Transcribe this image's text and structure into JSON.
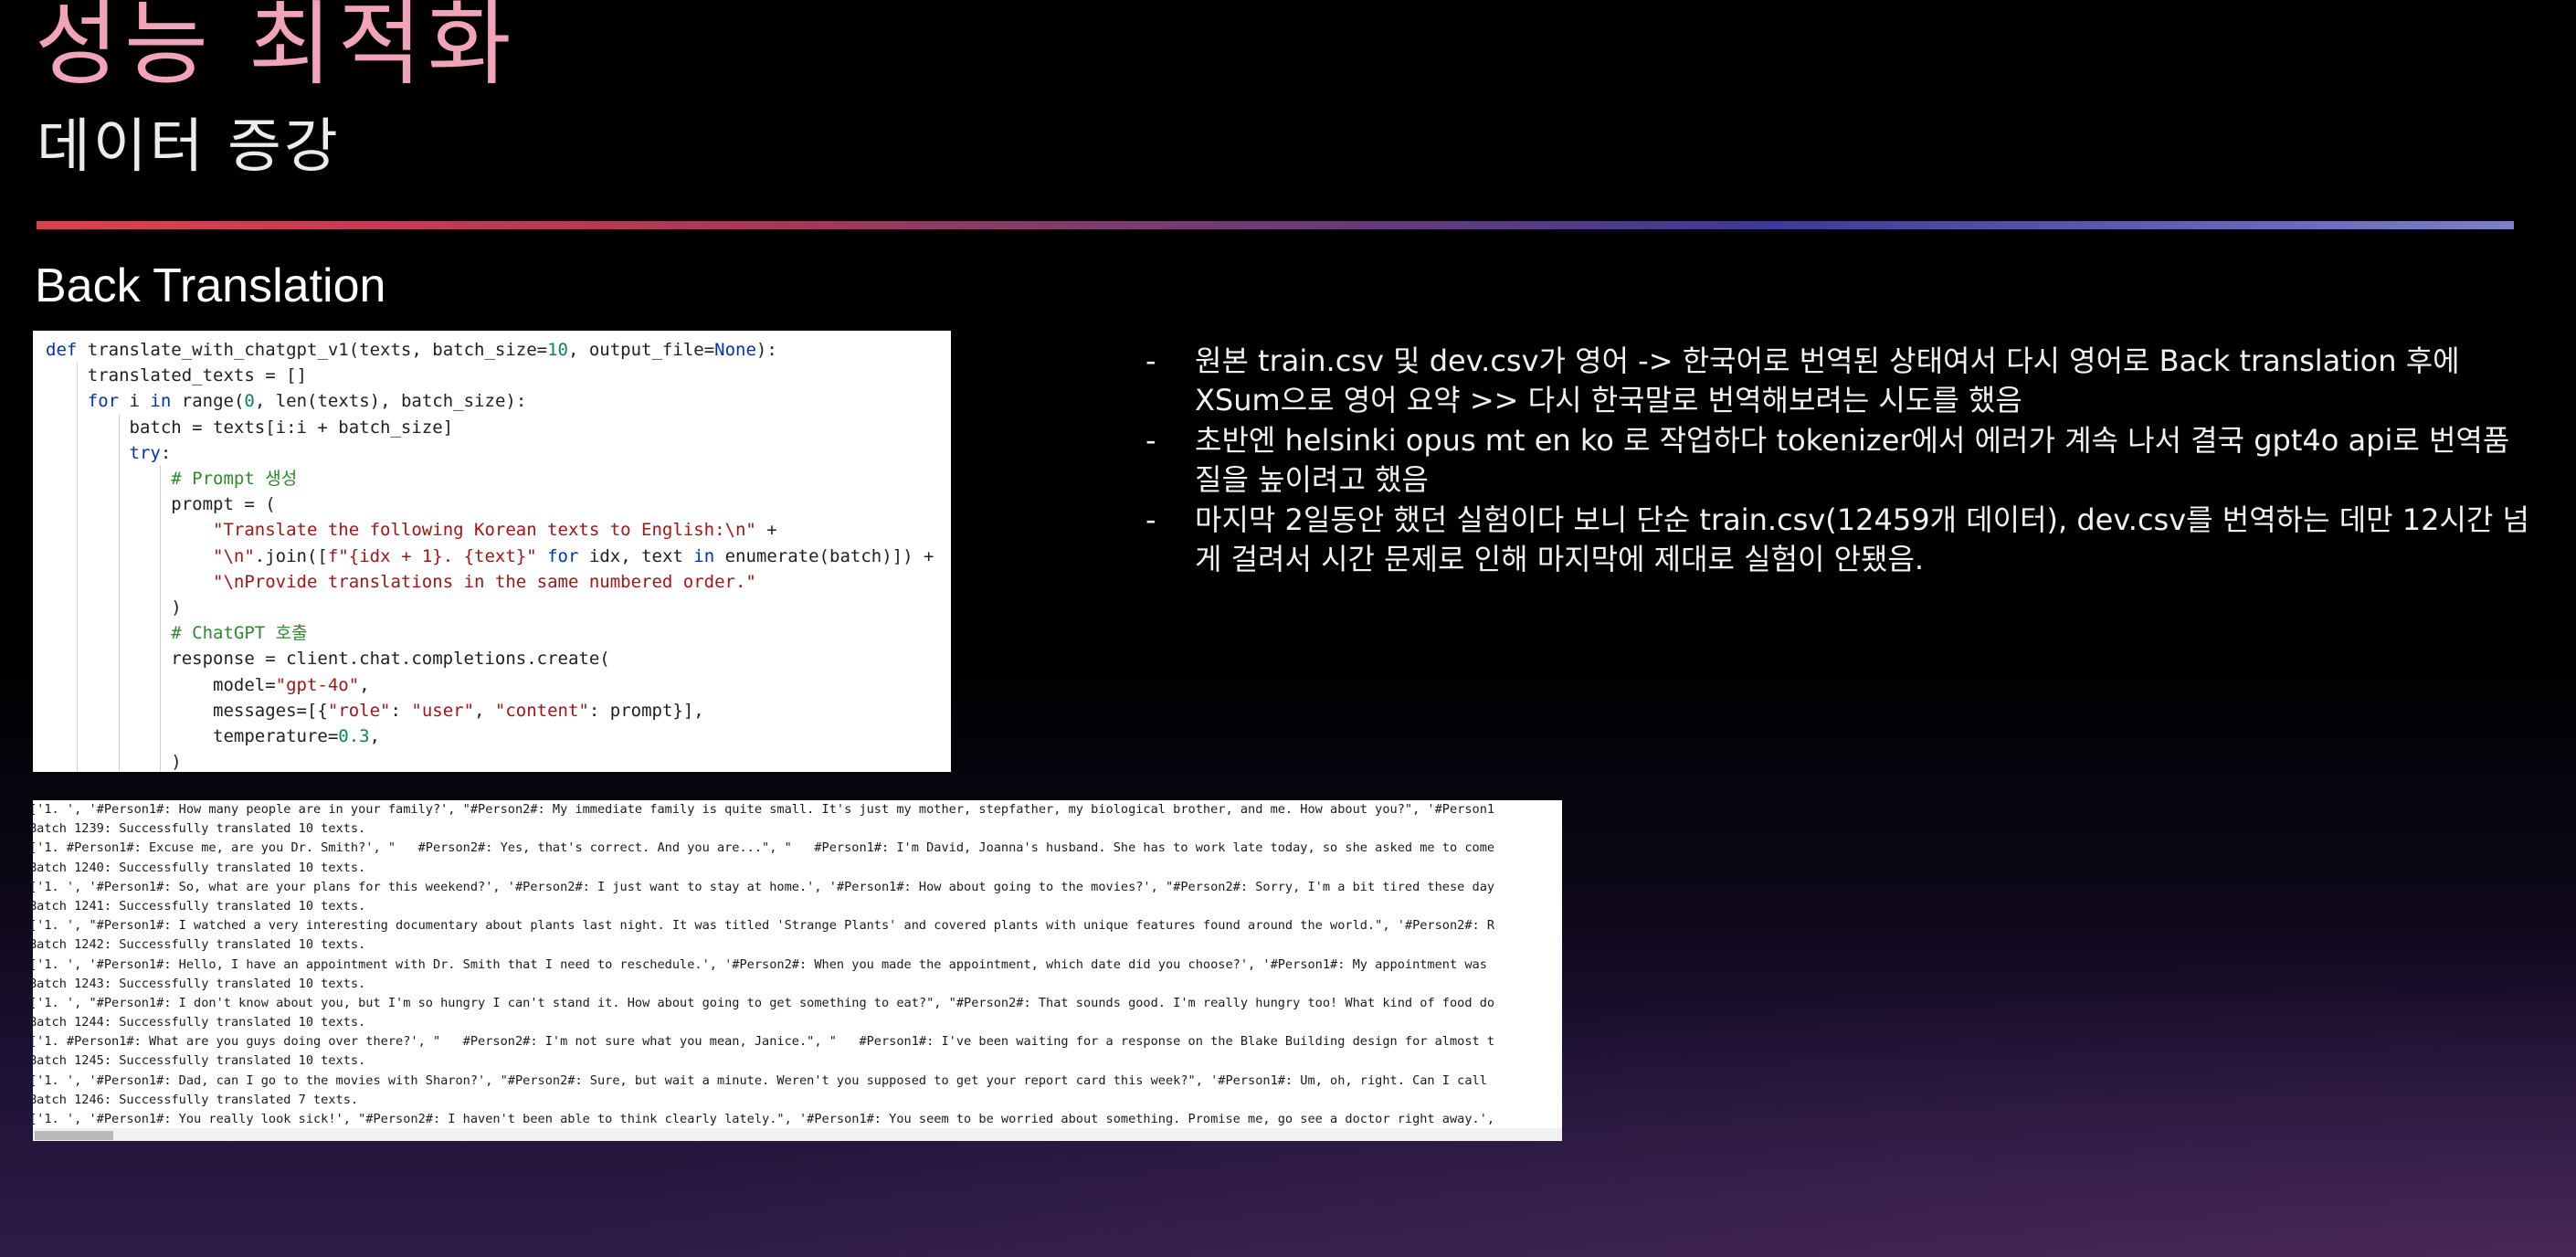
{
  "slide": {
    "title": "성능 최적화",
    "subtitle": "데이터 증강",
    "section_heading": "Back Translation"
  },
  "notes": [
    "원본 train.csv 및 dev.csv가 영어 -> 한국어로 번역된 상태여서 다시 영어로 Back translation 후에 XSum으로 영어 요약 >> 다시 한국말로 번역해보려는 시도를 했음",
    "초반엔 helsinki opus mt en ko 로 작업하다 tokenizer에서 에러가 계속 나서 결국 gpt4o api로 번역품질을 높이려고 했음",
    "마지막 2일동안 했던 실험이다 보니 단순 train.csv(12459개 데이터), dev.csv를 번역하는 데만 12시간 넘게 걸려서 시간 문제로 인해 마지막에 제대로 실험이 안됐음."
  ],
  "bullet_marker": "-",
  "code_lines": [
    "def translate_with_chatgpt_v1(texts, batch_size=10, output_file=None):",
    "    translated_texts = []",
    "    for i in range(0, len(texts), batch_size):",
    "        batch = texts[i:i + batch_size]",
    "        try:",
    "            # Prompt 생성",
    "            prompt = (",
    "                \"Translate the following Korean texts to English:\\n\" +",
    "                \"\\n\".join([f\"{idx + 1}. {text}\" for idx, text in enumerate(batch)]) +",
    "                \"\\nProvide translations in the same numbered order.\"",
    "            )",
    "            # ChatGPT 호출",
    "            response = client.chat.completions.create(",
    "                model=\"gpt-4o\",",
    "                messages=[{\"role\": \"user\", \"content\": prompt}],",
    "                temperature=0.3,",
    "            )"
  ],
  "log_lines": [
    "['1. ', '#Person1#: How many people are in your family?', \"#Person2#: My immediate family is quite small. It's just my mother, stepfather, my biological brother, and me. How about you?\", '#Person1",
    "Batch 1239: Successfully translated 10 texts.",
    "['1. #Person1#: Excuse me, are you Dr. Smith?', \"   #Person2#: Yes, that's correct. And you are...\", \"   #Person1#: I'm David, Joanna's husband. She has to work late today, so she asked me to come",
    "Batch 1240: Successfully translated 10 texts.",
    "['1. ', '#Person1#: So, what are your plans for this weekend?', '#Person2#: I just want to stay at home.', '#Person1#: How about going to the movies?', \"#Person2#: Sorry, I'm a bit tired these day",
    "Batch 1241: Successfully translated 10 texts.",
    "['1. ', \"#Person1#: I watched a very interesting documentary about plants last night. It was titled 'Strange Plants' and covered plants with unique features found around the world.\", '#Person2#: R",
    "Batch 1242: Successfully translated 10 texts.",
    "['1. ', '#Person1#: Hello, I have an appointment with Dr. Smith that I need to reschedule.', '#Person2#: When you made the appointment, which date did you choose?', '#Person1#: My appointment was",
    "Batch 1243: Successfully translated 10 texts.",
    "['1. ', \"#Person1#: I don't know about you, but I'm so hungry I can't stand it. How about going to get something to eat?\", \"#Person2#: That sounds good. I'm really hungry too! What kind of food do",
    "Batch 1244: Successfully translated 10 texts.",
    "['1. #Person1#: What are you guys doing over there?', \"   #Person2#: I'm not sure what you mean, Janice.\", \"   #Person1#: I've been waiting for a response on the Blake Building design for almost t",
    "Batch 1245: Successfully translated 10 texts.",
    "['1. ', '#Person1#: Dad, can I go to the movies with Sharon?', \"#Person2#: Sure, but wait a minute. Weren't you supposed to get your report card this week?\", '#Person1#: Um, oh, right. Can I call",
    "Batch 1246: Successfully translated 7 texts.",
    "['1. ', '#Person1#: You really look sick!', \"#Person2#: I haven't been able to think clearly lately.\", '#Person1#: You seem to be worried about something. Promise me, go see a doctor right away.',"
  ],
  "colors": {
    "title": "#f1a3b8",
    "keyword": "#0033b3",
    "string": "#a31515",
    "number": "#098658",
    "comment": "#2c8a2c"
  }
}
